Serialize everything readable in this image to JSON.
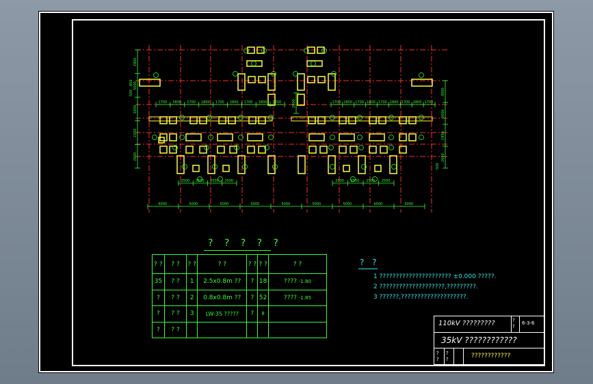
{
  "colors": {
    "background": "#000000",
    "frame": "#ffffff",
    "axis": "#ff2a2a",
    "structure": "#ffff33",
    "dimension": "#33ff33",
    "notes": "#2ee6e6",
    "viewport": "#7d8a98"
  },
  "plan": {
    "top_dims": [
      "1700",
      "1800",
      "1700",
      "1800",
      "1700",
      "1800",
      "1700",
      "1800",
      "1700"
    ],
    "top_dims_right": [
      "1700",
      "1800",
      "1700",
      "1800",
      "1700",
      "1800",
      "1700",
      "1800",
      "1700"
    ],
    "left_dims": [
      "2900",
      "5000",
      "2650",
      "2200",
      "2600"
    ],
    "right_dims": [
      "3000",
      "2000",
      "1950",
      "2650"
    ],
    "left_small": [
      "850",
      "500"
    ],
    "right_small": "500",
    "sub_dims_left": [
      "2500",
      "2500",
      "2500",
      "2500"
    ],
    "sub_dims_right": [
      "2500",
      "2500",
      "2500",
      "2500"
    ],
    "bottom_dims": [
      "6000",
      "5000",
      "5000",
      "5000",
      "5000",
      "5000",
      "5000",
      "6000",
      "5000"
    ],
    "left_vertical": "2900"
  },
  "table": {
    "title": "? ? ? ? ?",
    "header": [
      "?\n?",
      "? ?",
      "?\n?",
      "?   ?",
      "?\n?",
      "?\n?",
      "?   ?"
    ],
    "rows": [
      {
        "c0": "35",
        "c1": "? ?",
        "c2": "1",
        "c3": "2.5x0.8m ??",
        "c4": "?",
        "c5": "18",
        "c6": "????",
        "c6b": "-1.80"
      },
      {
        "c0": "?",
        "c1": "? ?",
        "c2": "2",
        "c3": "0.8x0.8m ??",
        "c4": "?",
        "c5": "52",
        "c6": "????",
        "c6b": "-1.85"
      },
      {
        "c0": "?",
        "c1": "? ?",
        "c2": "3",
        "c3": "LW-35  ?????",
        "c4": "?",
        "c5": "8",
        "c6": "",
        "c6b": ""
      },
      {
        "c0": "?",
        "c1": "? ?",
        "c2": "",
        "c3": "",
        "c4": "",
        "c5": "",
        "c6": "",
        "c6b": ""
      }
    ]
  },
  "notes": {
    "heading": "? ?",
    "line1": "1 ??????????????????????  ±0.000  ?????.",
    "line2": "2 ????????????????????,?????????.",
    "line3": "3 ??????,????????????????????."
  },
  "title_block": {
    "project": "110kV ?????????",
    "stage": "?\n?",
    "drawing_no": "6-3-6",
    "drawing_title": "35kV ????????????",
    "left_a": "?\n?",
    "left_b": "?\n?",
    "company": "????????????"
  }
}
